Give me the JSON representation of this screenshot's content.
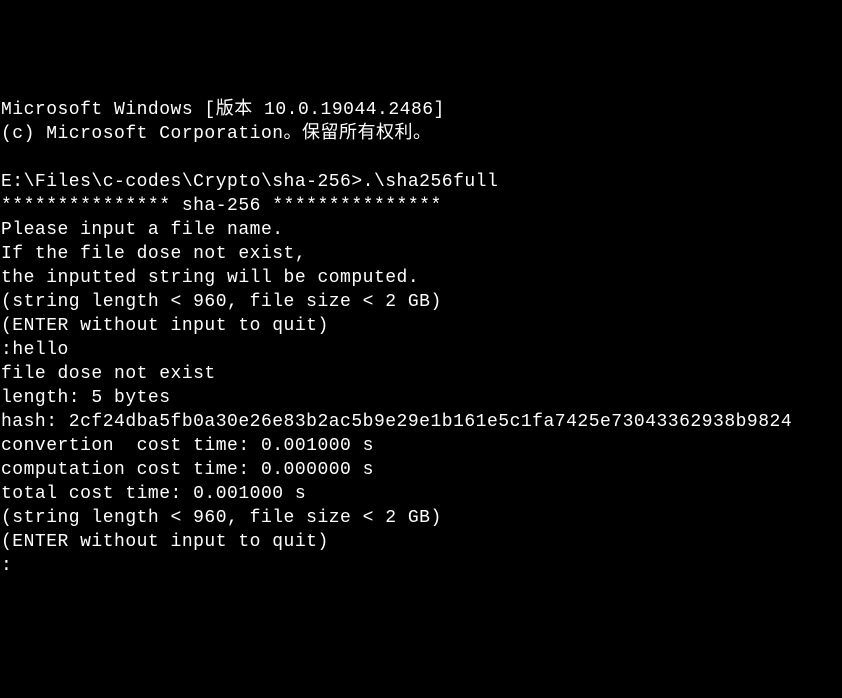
{
  "terminal": {
    "header_line1": "Microsoft Windows [版本 10.0.19044.2486]",
    "header_line2": "(c) Microsoft Corporation。保留所有权利。",
    "blank": "",
    "prompt_path": "E:\\Files\\c-codes\\Crypto\\sha-256>",
    "command": ".\\sha256full",
    "banner": "*************** sha-256 ***************",
    "instr1": "Please input a file name.",
    "instr2": "If the file dose not exist,",
    "instr3": "the inputted string will be computed.",
    "instr4": "(string length < 960, file size < 2 GB)",
    "instr5": "(ENTER without input to quit)",
    "input_prompt": ":",
    "user_input": "hello",
    "result1": "file dose not exist",
    "result2": "length: 5 bytes",
    "result3": "hash: 2cf24dba5fb0a30e26e83b2ac5b9e29e1b161e5c1fa7425e73043362938b9824",
    "result4": "convertion  cost time: 0.001000 s",
    "result5": "computation cost time: 0.000000 s",
    "result6": "total cost time: 0.001000 s",
    "repeat1": "(string length < 960, file size < 2 GB)",
    "repeat2": "(ENTER without input to quit)",
    "final_prompt": ":"
  }
}
